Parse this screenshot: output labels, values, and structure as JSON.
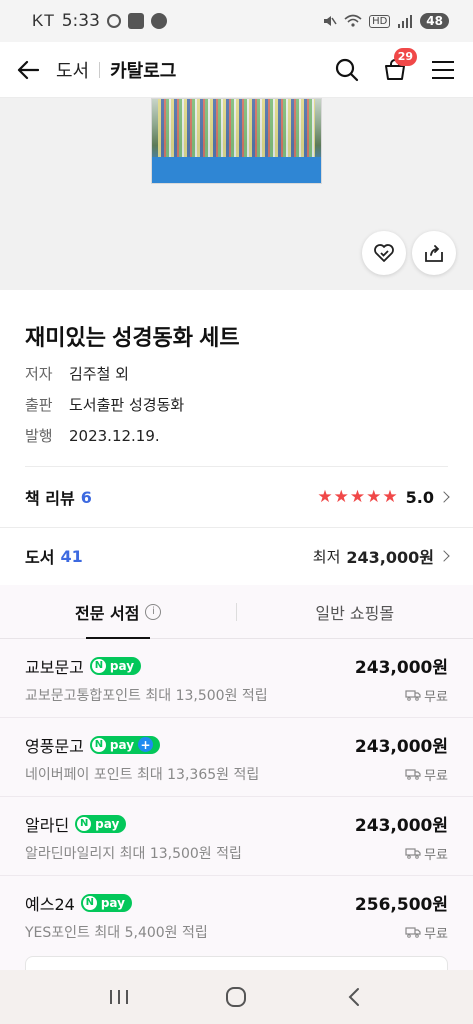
{
  "status_bar": {
    "carrier": "KT",
    "time": "5:33",
    "network": "HD",
    "battery": "48"
  },
  "header": {
    "breadcrumb_parent": "도서",
    "breadcrumb_current": "카탈로그",
    "cart_count": "29",
    "icons": [
      "back-arrow-icon",
      "search-icon",
      "cart-icon",
      "menu-icon"
    ]
  },
  "hero": {
    "buttons": [
      "wish-heart-icon",
      "share-icon"
    ]
  },
  "book": {
    "title": "재미있는 성경동화 세트",
    "meta": [
      {
        "key": "저자",
        "value": "김주철 외"
      },
      {
        "key": "출판",
        "value": "도서출판 성경동화"
      },
      {
        "key": "발행",
        "value": "2023.12.19."
      }
    ]
  },
  "reviews": {
    "label": "책 리뷰",
    "count": "6",
    "rating": "5.0",
    "stars": 5
  },
  "stores": {
    "label": "도서",
    "count": "41",
    "lowest_label": "최저",
    "lowest_price": "243,000원"
  },
  "tabs": [
    {
      "label": "전문 서점",
      "active": true
    },
    {
      "label": "일반 쇼핑몰",
      "active": false
    }
  ],
  "sellers": [
    {
      "name": "교보문고",
      "pay": "pay",
      "pay_plus": false,
      "price": "243,000원",
      "points": "교보문고통합포인트 최대 13,500원 적립",
      "shipping": "무료"
    },
    {
      "name": "영풍문고",
      "pay": "pay",
      "pay_plus": true,
      "price": "243,000원",
      "points": "네이버페이 포인트 최대 13,365원 적립",
      "shipping": "무료"
    },
    {
      "name": "알라딘",
      "pay": "pay",
      "pay_plus": false,
      "price": "243,000원",
      "points": "알라딘마일리지 최대 13,500원 적립",
      "shipping": "무료"
    },
    {
      "name": "예스24",
      "pay": "pay",
      "pay_plus": false,
      "price": "256,500원",
      "points": "YES포인트 최대 5,400원 적립",
      "shipping": "무료"
    }
  ],
  "nav": [
    "recent-apps-icon",
    "home-icon",
    "back-icon"
  ],
  "colors": {
    "accent_blue": "#3d6ae0",
    "star_red": "#f04848",
    "npay_green": "#03c75a",
    "badge_red": "#f04848"
  }
}
